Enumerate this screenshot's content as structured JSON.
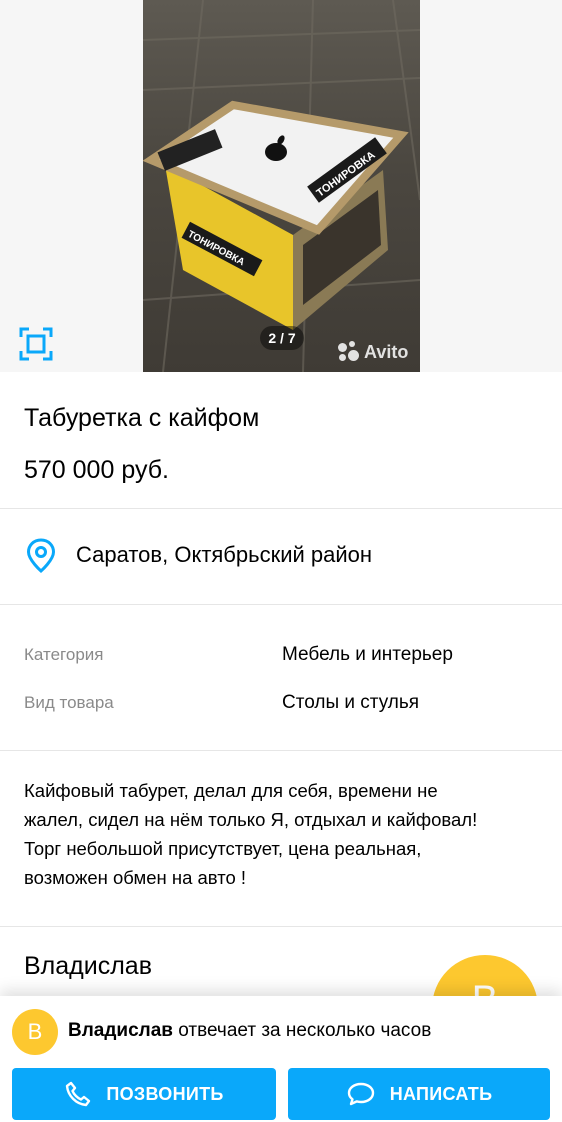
{
  "gallery": {
    "counter": "2 / 7",
    "watermark": "Avito",
    "photo_stickers": [
      "ТОНИРОВКА",
      "ТОНИРОВКА"
    ],
    "current_photo": 2,
    "total_photos": 7
  },
  "listing": {
    "title": "Табуретка с кайфом",
    "price": "570 000 руб.",
    "location": "Саратов, Октябрьский район",
    "params": [
      {
        "label": "Категория",
        "value": "Мебель и интерьер"
      },
      {
        "label": "Вид товара",
        "value": "Столы и стулья"
      }
    ],
    "description_lines": [
      "Кайфовый табурет, делал для себя, времени не",
      "жалел, сидел на нём только Я, отдыхал и кайфовал!",
      "Торг небольшой присутствует, цена реальная,",
      "возможен обмен на авто !"
    ]
  },
  "seller": {
    "name": "Владислав",
    "avatar_letter": "В",
    "response_text": "отвечает за несколько часов"
  },
  "actions": {
    "call_label": "ПОЗВОНИТЬ",
    "write_label": "НАПИСАТЬ"
  },
  "colors": {
    "accent": "#0aa8fa",
    "avatar": "#fdc82f",
    "secondary_text": "#8a8a8a"
  },
  "icons": [
    "fullscreen-icon",
    "location-pin-icon",
    "phone-icon",
    "chat-icon",
    "avito-logo-icon",
    "apple-logo-icon"
  ]
}
